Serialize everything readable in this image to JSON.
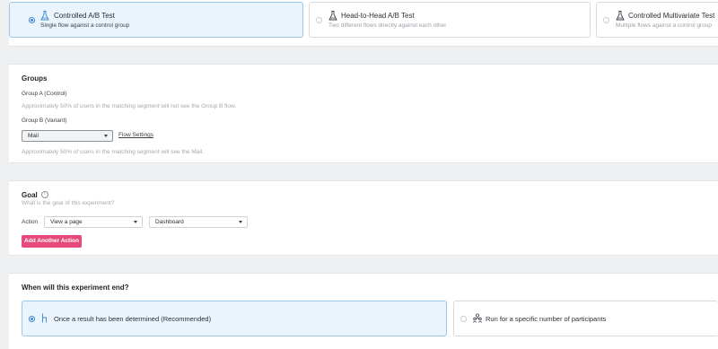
{
  "experiment_types": [
    {
      "title": "Controlled A/B Test",
      "subtitle": "Single flow against a control group",
      "selected": true,
      "icon": "flask-icon"
    },
    {
      "title": "Head-to-Head A/B Test",
      "subtitle": "Two different flows directly against each other",
      "selected": false,
      "icon": "flask-icon"
    },
    {
      "title": "Controlled Multivariate Test",
      "subtitle": "Multiple flows against a control group",
      "selected": false,
      "icon": "flask-icon"
    }
  ],
  "groups": {
    "title": "Groups",
    "group_a_label": "Group A (Control)",
    "group_a_hint": "Approximately 50% of users in the matching segment will not see the Group B flow.",
    "group_b_label": "Group B (Variant)",
    "group_b_value": "Mail",
    "flow_settings_link": "Flow Settings",
    "group_b_hint": "Approximately 50% of users in the matching segment will see the Mail."
  },
  "goal": {
    "title": "Goal",
    "info_icon": "info-icon",
    "subtitle": "What is the goal of this experiment?",
    "action_label": "Action",
    "action_value": "View a page",
    "page_value": "Dashboard",
    "add_button": "Add Another Action"
  },
  "end": {
    "title": "When will this experiment end?",
    "options": [
      {
        "label": "Once a result has been determined (Recommended)",
        "selected": true,
        "icon": "result-icon"
      },
      {
        "label": "Run for a specific number of participants",
        "selected": false,
        "icon": "participants-icon"
      }
    ]
  },
  "colors": {
    "accent": "#3a86d0",
    "primary_button": "#e64a7b",
    "selected_bg": "#eaf4fd"
  }
}
